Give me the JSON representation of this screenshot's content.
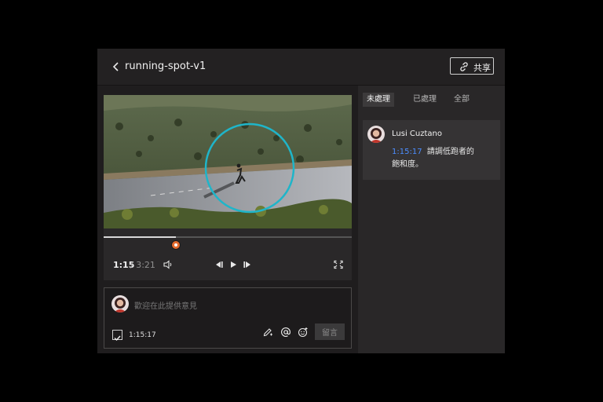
{
  "header": {
    "back_icon": "chevron-left-icon",
    "title": "running-spot-v1",
    "share_icon": "link-icon",
    "share_label": "共享"
  },
  "player": {
    "progress": 0.29,
    "comment_marker_position": 0.29,
    "current_time": "1:15",
    "duration": "/ 3:21",
    "icons": [
      "volume-icon",
      "previous-frame-icon",
      "play-icon",
      "next-frame-icon",
      "fullscreen-icon"
    ]
  },
  "composer": {
    "placeholder": "歡迎在此提供意見",
    "timestamp": "1:15:17",
    "timestamp_checked": true,
    "tools": [
      "annotate-pen-icon",
      "mention-at-icon",
      "emoji-icon"
    ],
    "submit_label": "留言"
  },
  "tabs": [
    {
      "label": "未處理",
      "active": true
    },
    {
      "label": "已處理",
      "active": false
    },
    {
      "label": "全部",
      "active": false
    }
  ],
  "comments": [
    {
      "author": "Lusi Cuztano",
      "timestamp": "1:15:17",
      "text_line1": "請調低跑者的",
      "text_line2": "飽和度。"
    }
  ],
  "colors": {
    "annotation_circle": "#1fb5c9",
    "timestamp_link": "#4c8dff",
    "marker": "#e36a2d"
  }
}
